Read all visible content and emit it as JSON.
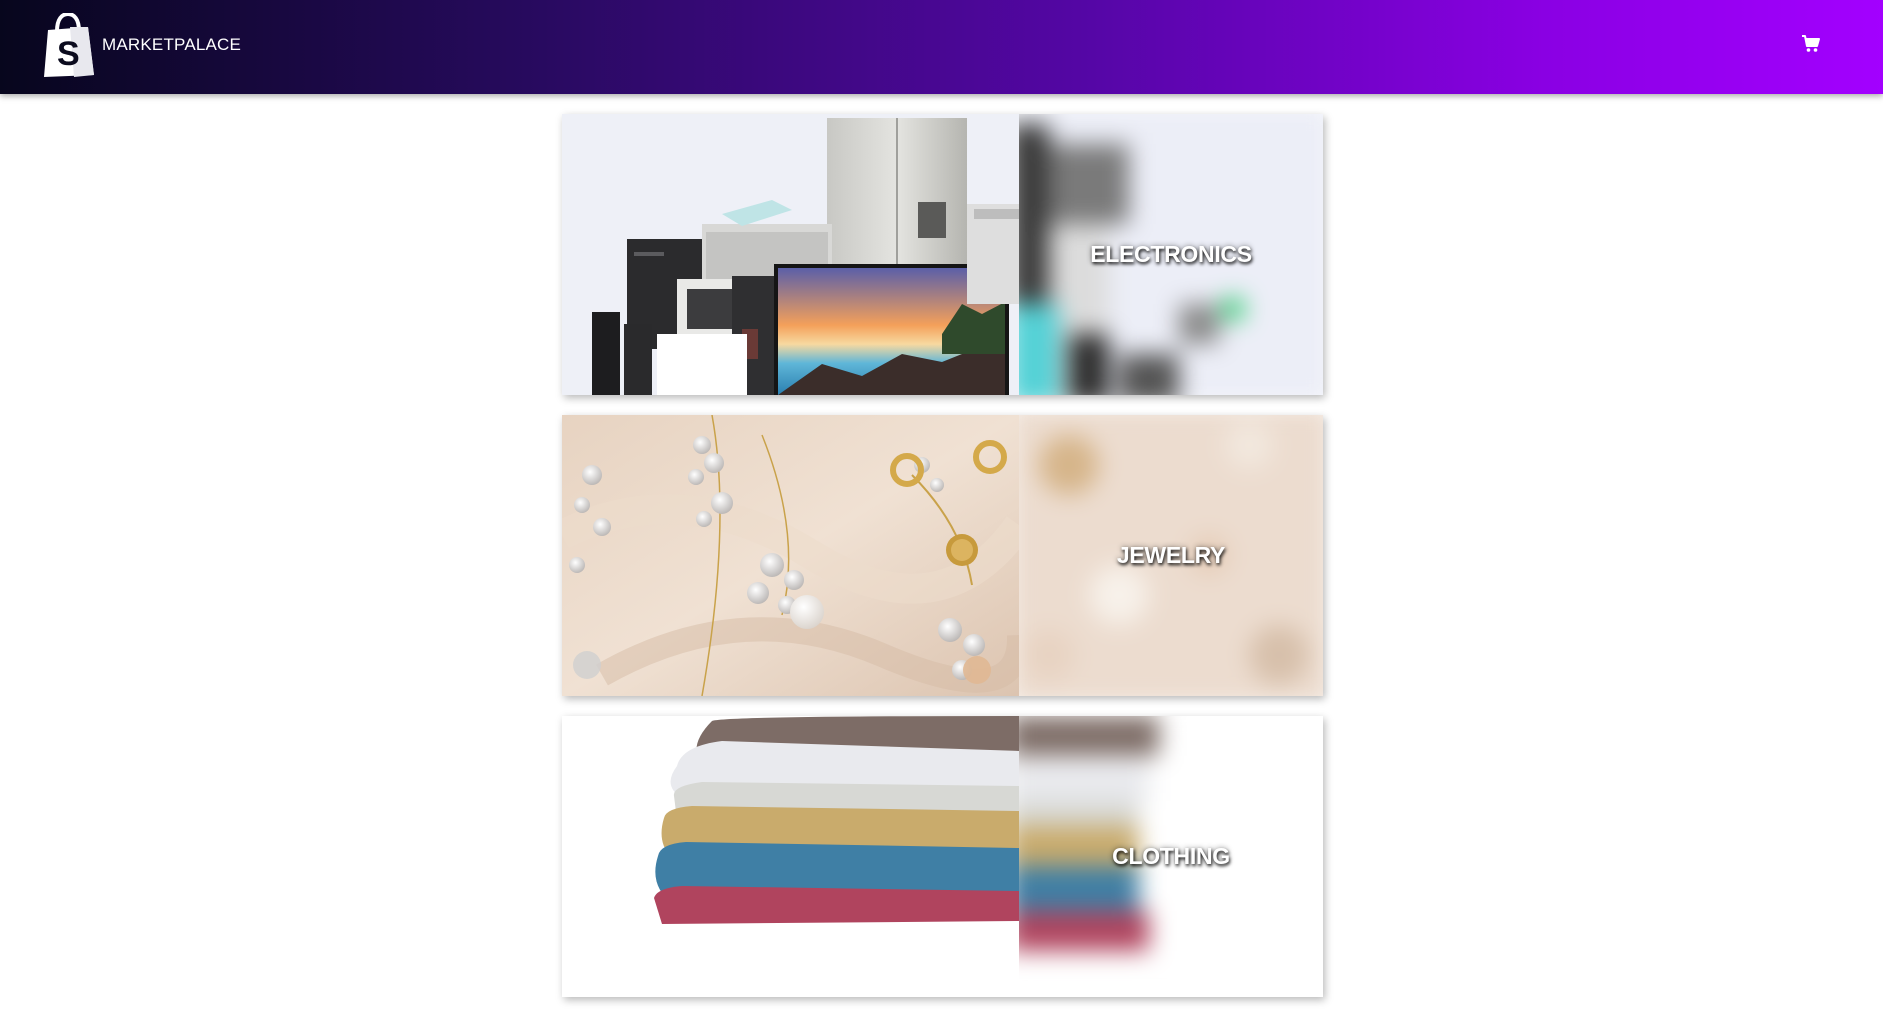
{
  "header": {
    "brand_name": "MARKETPALACE",
    "logo_icon": "shopping-bag-icon",
    "cart_icon": "shopping-cart-icon",
    "colors": {
      "gradient_start": "#07061d",
      "gradient_end": "#a300ff"
    }
  },
  "categories": [
    {
      "title": "ELECTRONICS"
    },
    {
      "title": "JEWELRY"
    },
    {
      "title": "CLOTHING"
    }
  ]
}
